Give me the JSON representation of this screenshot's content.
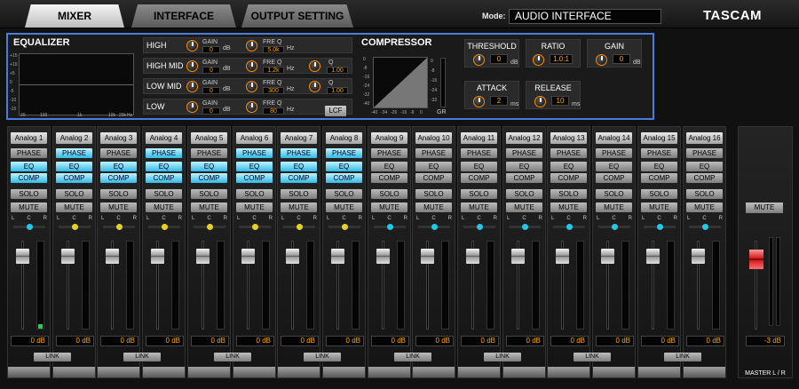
{
  "tabs": [
    {
      "label": "MIXER",
      "active": true
    },
    {
      "label": "INTERFACE",
      "active": false
    },
    {
      "label": "OUTPUT SETTING",
      "active": false
    }
  ],
  "mode": {
    "label": "Mode:",
    "value": "AUDIO INTERFACE"
  },
  "brand": "TASCAM",
  "equalizer": {
    "title": "EQUALIZER",
    "graph_x_labels": [
      "20",
      "100",
      "1k",
      "10k",
      "20k",
      "Hz"
    ],
    "graph_y_labels": [
      "+15",
      "+10",
      "+5",
      "0",
      "-5",
      "-10",
      "-15"
    ],
    "gain_label": "GAIN",
    "freq_label": "FRE Q",
    "q_label": "Q",
    "db_unit": "dB",
    "hz_unit": "Hz",
    "lcf_label": "LCF",
    "bands": [
      {
        "name": "HIGH",
        "gain": "0",
        "freq": "5.0k",
        "q": ""
      },
      {
        "name": "HIGH MID",
        "gain": "0",
        "freq": "1.2k",
        "q": "1.00"
      },
      {
        "name": "LOW MID",
        "gain": "0",
        "freq": "300",
        "q": "1.00"
      },
      {
        "name": "LOW",
        "gain": "0",
        "freq": "80",
        "q": ""
      }
    ]
  },
  "compressor": {
    "title": "COMPRESSOR",
    "gr_label": "GR",
    "threshold": {
      "label": "THRESHOLD",
      "value": "0",
      "unit": "dB"
    },
    "ratio": {
      "label": "RATIO",
      "value": "1.0:1"
    },
    "gain": {
      "label": "GAIN",
      "value": "0",
      "unit": "dB"
    },
    "attack": {
      "label": "ATTACK",
      "value": "2",
      "unit": "ms"
    },
    "release": {
      "label": "RELEASE",
      "value": "10",
      "unit": "ms"
    },
    "graph_y_labels": [
      "0",
      "-8",
      "-16",
      "-24",
      "-32",
      "-40"
    ],
    "graph_x_labels": [
      "-40",
      "-34",
      "-26",
      "-16",
      "-8",
      "0"
    ],
    "meter_labels": [
      "0",
      "-8",
      "-16",
      "-24",
      "-32"
    ]
  },
  "strip_labels": {
    "phase": "PHASE",
    "eq": "EQ",
    "comp": "COMP",
    "solo": "SOLO",
    "mute": "MUTE",
    "pan_l": "L",
    "pan_c": "C",
    "pan_r": "R",
    "link": "LINK"
  },
  "channels": [
    {
      "name": "Analog 1",
      "phase": false,
      "eq": true,
      "comp": true,
      "pan_color": "#24c7e6",
      "db": "0 dB",
      "level": 0.05
    },
    {
      "name": "Analog 2",
      "phase": true,
      "eq": true,
      "comp": true,
      "pan_color": "#e6d024",
      "db": "0 dB",
      "level": 0
    },
    {
      "name": "Analog 3",
      "phase": false,
      "eq": true,
      "comp": true,
      "pan_color": "#e6d024",
      "db": "0 dB",
      "level": 0
    },
    {
      "name": "Analog 4",
      "phase": true,
      "eq": true,
      "comp": true,
      "pan_color": "#e6d024",
      "db": "0 dB",
      "level": 0
    },
    {
      "name": "Analog 5",
      "phase": false,
      "eq": true,
      "comp": true,
      "pan_color": "#e6d024",
      "db": "0 dB",
      "level": 0
    },
    {
      "name": "Analog 6",
      "phase": true,
      "eq": true,
      "comp": true,
      "pan_color": "#e6d024",
      "db": "0 dB",
      "level": 0
    },
    {
      "name": "Analog 7",
      "phase": true,
      "eq": true,
      "comp": true,
      "pan_color": "#e6d024",
      "db": "0 dB",
      "level": 0
    },
    {
      "name": "Analog 8",
      "phase": true,
      "eq": true,
      "comp": true,
      "pan_color": "#e6d024",
      "db": "0 dB",
      "level": 0
    },
    {
      "name": "Analog 9",
      "phase": false,
      "eq": false,
      "comp": false,
      "pan_color": "#24c7e6",
      "db": "0 dB",
      "level": 0
    },
    {
      "name": "Analog 10",
      "phase": false,
      "eq": false,
      "comp": false,
      "pan_color": "#24c7e6",
      "db": "0 dB",
      "level": 0
    },
    {
      "name": "Analog 11",
      "phase": false,
      "eq": false,
      "comp": false,
      "pan_color": "#24c7e6",
      "db": "0 dB",
      "level": 0
    },
    {
      "name": "Analog 12",
      "phase": false,
      "eq": false,
      "comp": false,
      "pan_color": "#24c7e6",
      "db": "0 dB",
      "level": 0
    },
    {
      "name": "Analog 13",
      "phase": false,
      "eq": false,
      "comp": false,
      "pan_color": "#24c7e6",
      "db": "0 dB",
      "level": 0
    },
    {
      "name": "Analog 14",
      "phase": false,
      "eq": false,
      "comp": false,
      "pan_color": "#24c7e6",
      "db": "0 dB",
      "level": 0
    },
    {
      "name": "Analog 15",
      "phase": false,
      "eq": false,
      "comp": false,
      "pan_color": "#24c7e6",
      "db": "0 dB",
      "level": 0
    },
    {
      "name": "Analog 16",
      "phase": false,
      "eq": false,
      "comp": false,
      "pan_color": "#24c7e6",
      "db": "0 dB",
      "level": 0
    }
  ],
  "master": {
    "mute": "MUTE",
    "db": "-3 dB",
    "label": "MASTER L / R"
  },
  "colors": {
    "accent_blue": "#4a7be0",
    "value_orange": "#ffa500",
    "active_cyan": "#33b8e6",
    "master_red": "#d11a1a"
  }
}
